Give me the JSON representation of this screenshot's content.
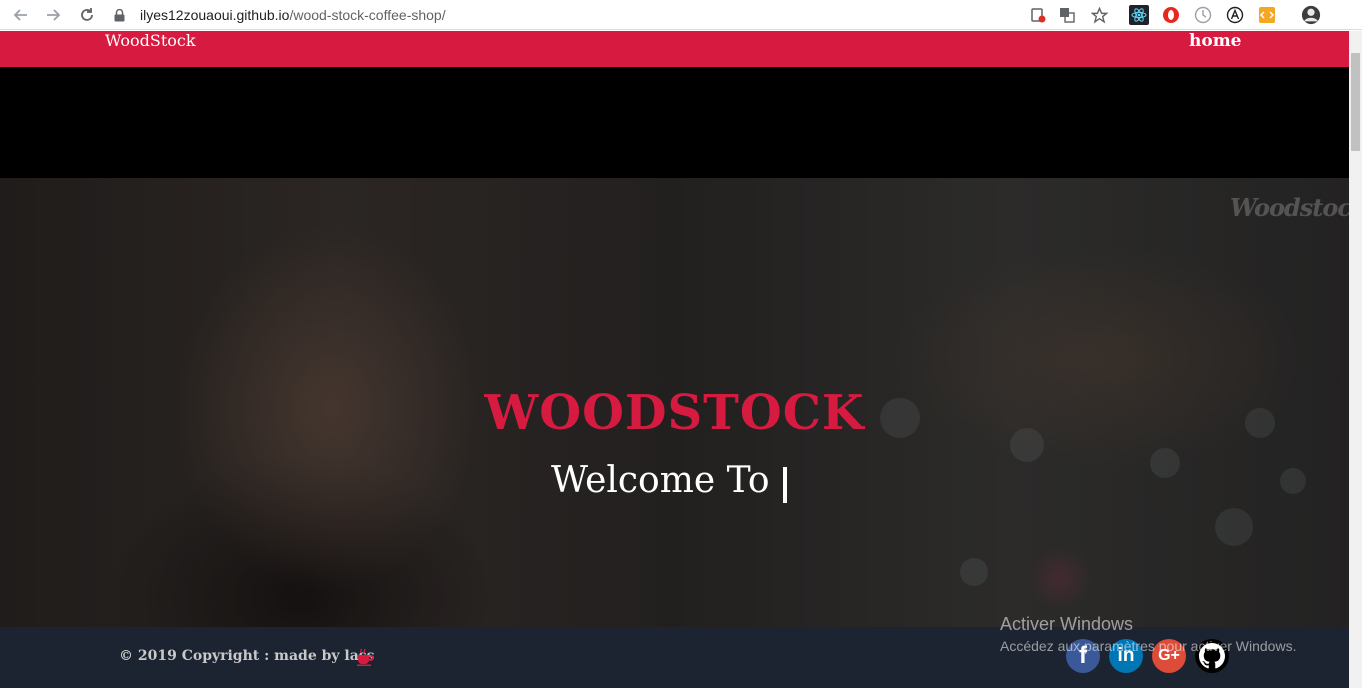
{
  "browser": {
    "url_domain": "ilyes12zouaoui.github.io",
    "url_path": "/wood-stock-coffee-shop/",
    "back_icon": "arrow-left",
    "forward_icon": "arrow-right",
    "reload_icon": "reload",
    "extensions": [
      "block-icon",
      "translate-icon",
      "star-icon",
      "react-devtools-icon",
      "opera-icon",
      "timer-icon",
      "a-icon",
      "html-icon",
      "profile-avatar"
    ]
  },
  "navbar": {
    "brand": "WoodStock",
    "links": [
      {
        "label": "home"
      }
    ]
  },
  "hero": {
    "logo_text": "Woodstock",
    "title": "WOODSTOCK",
    "subtitle": "Welcome To"
  },
  "footer": {
    "copyright": "© 2019 Copyright : made by lass",
    "social": [
      {
        "name": "facebook",
        "glyph": "f"
      },
      {
        "name": "linkedin",
        "glyph": "in"
      },
      {
        "name": "google-plus",
        "glyph": "G+"
      },
      {
        "name": "github",
        "glyph": ""
      }
    ]
  },
  "os_watermark": {
    "title": "Activer Windows",
    "subtitle": "Accédez aux paramètres pour activer Windows."
  },
  "colors": {
    "brand_red": "#d71b40",
    "footer_bg": "#1c2331"
  }
}
